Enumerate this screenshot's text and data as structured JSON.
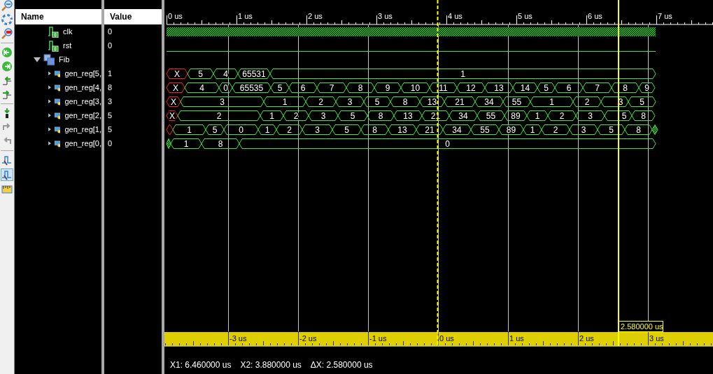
{
  "columns": [
    "Name",
    "Value"
  ],
  "signals": [
    {
      "name": "clk",
      "value": "0",
      "kind": "clock"
    },
    {
      "name": "rst",
      "value": "0",
      "kind": "bit"
    },
    {
      "name": "Fib",
      "kind": "group",
      "expanded": true,
      "children": [
        {
          "name": "gen_reg[5,",
          "value": "1",
          "expanded": false,
          "segments": [
            {
              "kind": "unknown",
              "text": "X"
            },
            {
              "kind": "value",
              "text": "5"
            },
            {
              "kind": "value",
              "text": "4"
            },
            {
              "kind": "value",
              "text": "65531"
            },
            {
              "kind": "value",
              "text": "1"
            }
          ]
        },
        {
          "name": "gen_reg[4,",
          "value": "8",
          "expanded": false,
          "segments": [
            {
              "kind": "unknown",
              "text": "X"
            },
            {
              "kind": "value",
              "text": "4"
            },
            {
              "kind": "value",
              "text": "0"
            },
            {
              "kind": "value",
              "text": "65535"
            },
            {
              "kind": "value",
              "text": "5"
            },
            {
              "kind": "value",
              "text": "6"
            },
            {
              "kind": "value",
              "text": "7"
            },
            {
              "kind": "value",
              "text": "8"
            },
            {
              "kind": "value",
              "text": "9"
            },
            {
              "kind": "value",
              "text": "10"
            },
            {
              "kind": "value",
              "text": "11"
            },
            {
              "kind": "value",
              "text": "12"
            },
            {
              "kind": "value",
              "text": "13"
            },
            {
              "kind": "value",
              "text": "14"
            },
            {
              "kind": "value",
              "text": "5"
            },
            {
              "kind": "value",
              "text": "6"
            },
            {
              "kind": "value",
              "text": "7"
            },
            {
              "kind": "value",
              "text": "8"
            },
            {
              "kind": "value",
              "text": "9"
            }
          ]
        },
        {
          "name": "gen_reg[3,",
          "value": "3",
          "expanded": false,
          "segments": [
            {
              "kind": "unknown",
              "text": "X"
            },
            {
              "kind": "value",
              "text": "3"
            },
            {
              "kind": "value",
              "text": "1"
            },
            {
              "kind": "value",
              "text": "2"
            },
            {
              "kind": "value",
              "text": "3"
            },
            {
              "kind": "value",
              "text": "5"
            },
            {
              "kind": "value",
              "text": "8"
            },
            {
              "kind": "value",
              "text": "13"
            },
            {
              "kind": "value",
              "text": "21"
            },
            {
              "kind": "value",
              "text": "34"
            },
            {
              "kind": "value",
              "text": "55"
            },
            {
              "kind": "value",
              "text": "1"
            },
            {
              "kind": "value",
              "text": "2"
            },
            {
              "kind": "value",
              "text": "3"
            },
            {
              "kind": "value",
              "text": "5"
            }
          ]
        },
        {
          "name": "gen_reg[2,",
          "value": "5",
          "expanded": false,
          "segments": [
            {
              "kind": "unknown",
              "text": "X"
            },
            {
              "kind": "value",
              "text": "2"
            },
            {
              "kind": "value",
              "text": "1"
            },
            {
              "kind": "value",
              "text": "2"
            },
            {
              "kind": "value",
              "text": "3"
            },
            {
              "kind": "value",
              "text": "5"
            },
            {
              "kind": "value",
              "text": "8"
            },
            {
              "kind": "value",
              "text": "13"
            },
            {
              "kind": "value",
              "text": "21"
            },
            {
              "kind": "value",
              "text": "34"
            },
            {
              "kind": "value",
              "text": "55"
            },
            {
              "kind": "value",
              "text": "89"
            },
            {
              "kind": "value",
              "text": "1"
            },
            {
              "kind": "value",
              "text": "2"
            },
            {
              "kind": "value",
              "text": "3"
            },
            {
              "kind": "value",
              "text": "5"
            },
            {
              "kind": "value",
              "text": "8"
            }
          ]
        },
        {
          "name": "gen_reg[1,",
          "value": "5",
          "expanded": false,
          "segments": [
            {
              "kind": "unknown"
            },
            {
              "kind": "value",
              "text": "1"
            },
            {
              "kind": "value",
              "text": "5"
            },
            {
              "kind": "value",
              "text": "0"
            },
            {
              "kind": "value",
              "text": "1"
            },
            {
              "kind": "value",
              "text": "2"
            },
            {
              "kind": "value",
              "text": "3"
            },
            {
              "kind": "value",
              "text": "5"
            },
            {
              "kind": "value",
              "text": "8"
            },
            {
              "kind": "value",
              "text": "13"
            },
            {
              "kind": "value",
              "text": "21"
            },
            {
              "kind": "value",
              "text": "34"
            },
            {
              "kind": "value",
              "text": "55"
            },
            {
              "kind": "value",
              "text": "89"
            },
            {
              "kind": "value",
              "text": "1"
            },
            {
              "kind": "value",
              "text": "2"
            },
            {
              "kind": "value",
              "text": "3"
            },
            {
              "kind": "value",
              "text": "5"
            },
            {
              "kind": "value",
              "text": "8"
            },
            {
              "kind": "glitch"
            }
          ]
        },
        {
          "name": "gen_reg[0,",
          "value": "0",
          "expanded": false,
          "segments": [
            {
              "kind": "hatched"
            },
            {
              "kind": "value",
              "text": "1"
            },
            {
              "kind": "value",
              "text": "8"
            },
            {
              "kind": "value",
              "text": "0"
            }
          ]
        }
      ]
    }
  ],
  "time_ruler": [
    "0 us",
    "1 us",
    "2 us",
    "3 us",
    "4 us",
    "5 us",
    "6 us",
    "7 us"
  ],
  "cursor_label": "2.580000 us",
  "delta_ruler": [
    "-3 us",
    "-2 us",
    "-1 us",
    "0 us",
    "1 us",
    "2 us",
    "3 us"
  ],
  "status": [
    "X1: 6.460000 us",
    "X2: 3.880000 us",
    "ΔX: 2.580000 us"
  ]
}
